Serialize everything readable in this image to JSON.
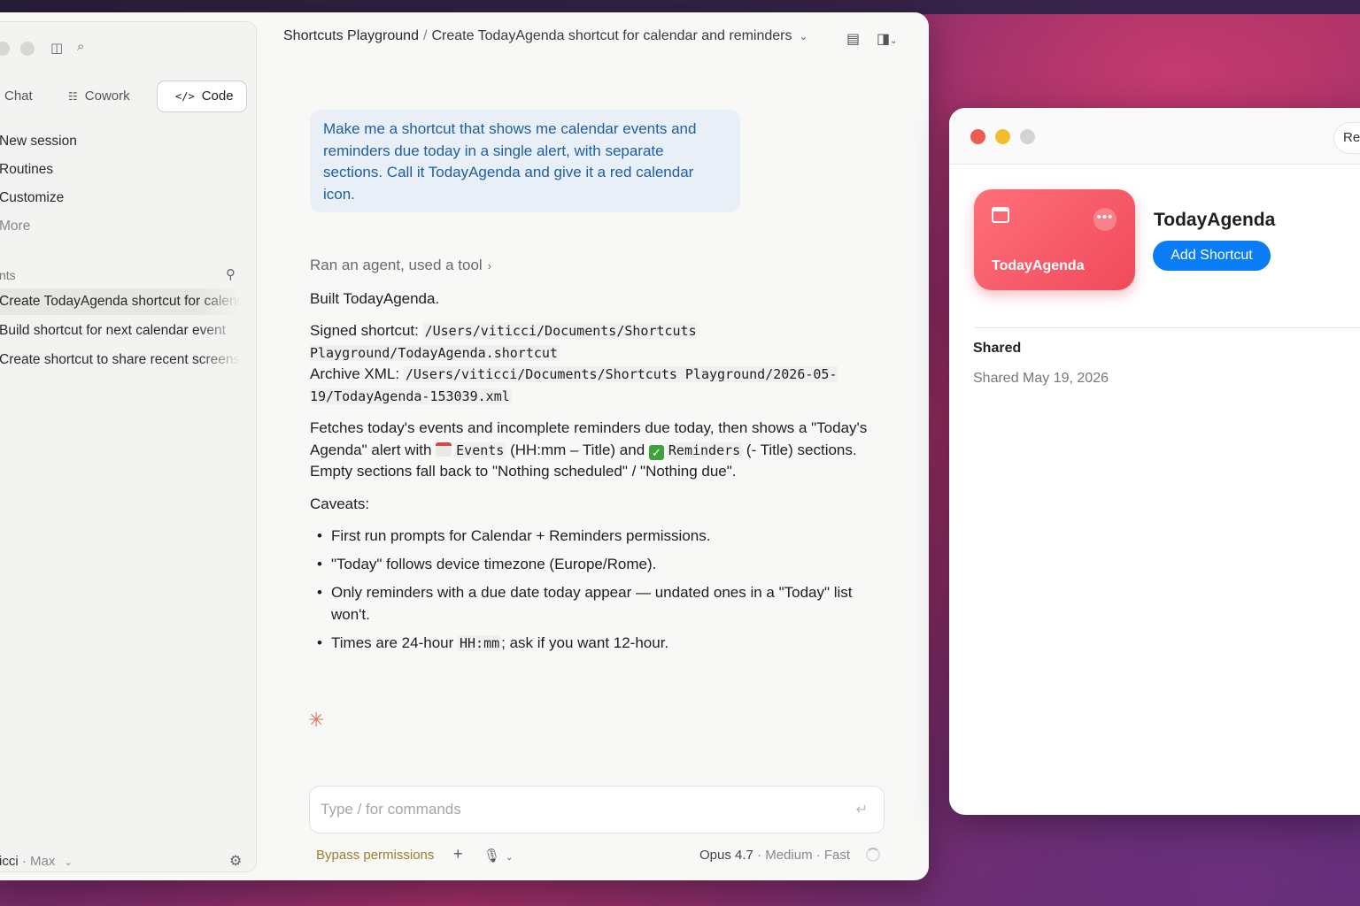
{
  "sidebar": {
    "tabs": [
      "Chat",
      "Cowork",
      "Code"
    ],
    "nav": [
      "New session",
      "Routines",
      "Customize",
      "More"
    ],
    "recents_label": "nts",
    "recents": [
      "Create TodayAgenda shortcut for calendar and reminders",
      "Build shortcut for next calendar event",
      "Create shortcut to share recent screenshots"
    ],
    "user": "icci",
    "plan": "· Max"
  },
  "header": {
    "project": "Shortcuts Playground",
    "separator": "/",
    "session": "Create TodayAgenda shortcut for calendar and reminders"
  },
  "conversation": {
    "user_message": "Make me a shortcut that shows me calendar events and reminders due today in a single alert, with separate sections. Call it TodayAgenda and give it a red calendar icon.",
    "agent_line": "Ran an agent, used a tool",
    "built": "Built TodayAgenda.",
    "signed_label": "Signed shortcut:",
    "signed_path": "/Users/viticci/Documents/Shortcuts Playground/TodayAgenda.shortcut",
    "archive_label": "Archive XML:",
    "archive_path": "/Users/viticci/Documents/Shortcuts Playground/2026-05-19/TodayAgenda-153039.xml",
    "desc_1": "Fetches today's events and incomplete reminders due today, then shows a \"Today's Agenda\" alert with",
    "events_code": "Events",
    "desc_2": "(HH:mm – Title) and",
    "reminders_code": "Reminders",
    "desc_3": "(- Title) sections. Empty sections fall back to \"Nothing scheduled\" / \"Nothing due\".",
    "caveats_label": "Caveats:",
    "caveats": [
      "First run prompts for Calendar + Reminders permissions.",
      "\"Today\" follows device timezone (Europe/Rome).",
      "Only reminders with a due date today appear — undated ones in a \"Today\" list won't."
    ],
    "caveat_4_pre": "Times are 24-hour",
    "caveat_4_code": "HH:mm",
    "caveat_4_post": "; ask if you want 12-hour."
  },
  "composer": {
    "placeholder": "Type / for commands",
    "bypass": "Bypass permissions",
    "model": "Opus 4.7",
    "effort": "· Medium",
    "speed": "· Fast"
  },
  "shortcuts_window": {
    "re_button": "Re",
    "card_label": "TodayAgenda",
    "title": "TodayAgenda",
    "add_button": "Add Shortcut",
    "shared_heading": "Shared",
    "shared_date": "Shared May 19, 2026",
    "card_color": "#f04a5a",
    "button_color": "#0a7cf5"
  },
  "icons": [
    "sidebar-toggle-icon",
    "search-icon",
    "chat-icon",
    "cowork-icon",
    "code-icon",
    "filter-icon",
    "settings-icon",
    "document-icon",
    "panel-icon",
    "plus-icon",
    "mic-icon",
    "enter-icon",
    "calendar-icon",
    "more-icon",
    "sparkle-icon"
  ]
}
